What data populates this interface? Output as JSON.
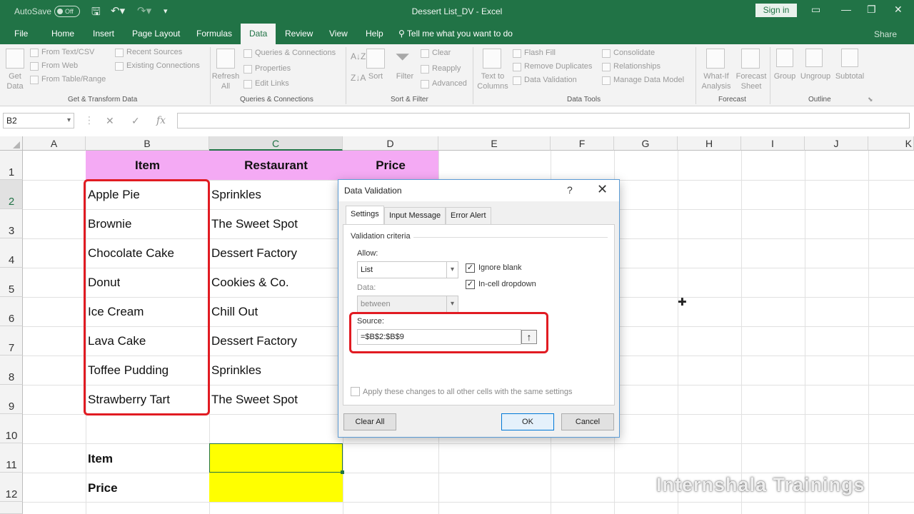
{
  "titlebar": {
    "autosave_label": "AutoSave",
    "autosave_state": "Off",
    "doc_title": "Dessert List_DV  -  Excel",
    "sign_in": "Sign in"
  },
  "ribbon_tabs": [
    "File",
    "Home",
    "Insert",
    "Page Layout",
    "Formulas",
    "Data",
    "Review",
    "View",
    "Help"
  ],
  "active_tab": "Data",
  "tell_me": "Tell me what you want to do",
  "share": "Share",
  "ribbon": {
    "get_data": "Get Data",
    "get_transform_items": [
      "From Text/CSV",
      "From Web",
      "From Table/Range"
    ],
    "recent_items": [
      "Recent Sources",
      "Existing Connections"
    ],
    "get_transform_label": "Get & Transform Data",
    "refresh_all": "Refresh All",
    "queries_items": [
      "Queries & Connections",
      "Properties",
      "Edit Links"
    ],
    "queries_label": "Queries & Connections",
    "sort": "Sort",
    "filter": "Filter",
    "filter_items": [
      "Clear",
      "Reapply",
      "Advanced"
    ],
    "sort_filter_label": "Sort & Filter",
    "text_to_columns": "Text to Columns",
    "data_tools_items": [
      "Flash Fill",
      "Remove Duplicates",
      "Data Validation"
    ],
    "data_tools_items2": [
      "Consolidate",
      "Relationships",
      "Manage Data Model"
    ],
    "data_tools_label": "Data Tools",
    "what_if": "What-If Analysis",
    "forecast_sheet": "Forecast Sheet",
    "forecast_label": "Forecast",
    "outline_items": [
      "Group",
      "Ungroup",
      "Subtotal"
    ],
    "outline_label": "Outline"
  },
  "name_box": "B2",
  "fx": "fx",
  "columns": [
    "A",
    "B",
    "C",
    "D",
    "E",
    "F",
    "G",
    "H",
    "I",
    "J",
    "K"
  ],
  "rows": [
    "1",
    "2",
    "3",
    "4",
    "5",
    "6",
    "7",
    "8",
    "9",
    "10",
    "11",
    "12"
  ],
  "table_headers": {
    "item": "Item",
    "restaurant": "Restaurant",
    "price": "Price"
  },
  "items": [
    "Apple Pie",
    "Brownie",
    "Chocolate Cake",
    "Donut",
    "Ice Cream",
    "Lava Cake",
    "Toffee Pudding",
    "Strawberry Tart"
  ],
  "restaurants": [
    "Sprinkles",
    "The Sweet Spot",
    "Dessert Factory",
    "Cookies & Co.",
    "Chill Out",
    "Dessert Factory",
    "Sprinkles",
    "The Sweet Spot"
  ],
  "lookup_labels": {
    "item": "Item",
    "price": "Price"
  },
  "dialog": {
    "title": "Data Validation",
    "help": "?",
    "tabs": [
      "Settings",
      "Input Message",
      "Error Alert"
    ],
    "section": "Validation criteria",
    "allow_label": "Allow:",
    "allow_value": "List",
    "data_label": "Data:",
    "data_value": "between",
    "ignore_blank": "Ignore blank",
    "in_cell_dropdown": "In-cell dropdown",
    "source_label": "Source:",
    "source_value": "=$B$2:$B$9",
    "apply_all": "Apply these changes to all other cells with the same settings",
    "clear_all": "Clear All",
    "ok": "OK",
    "cancel": "Cancel"
  },
  "watermark": "Internshala Trainings",
  "colors": {
    "excel_green": "#217346",
    "header_fill": "#f4aaf4",
    "input_fill": "#ffff00",
    "highlight": "#e11b22"
  }
}
